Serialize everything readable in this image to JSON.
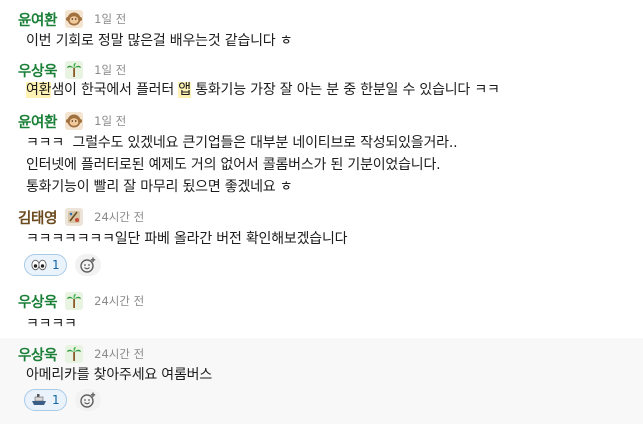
{
  "messages": [
    {
      "author": "윤여환",
      "avatar_icon": "monkey-emoji-icon",
      "time": "1일 전",
      "lines": [
        "이번 기회로 정말 많은걸 배우는것 같습니다 ㅎ"
      ]
    },
    {
      "author": "우상욱",
      "avatar_icon": "palm-tree-emoji-icon",
      "time": "1일 전",
      "mention": "여환",
      "rest": "샘이 한국에서 플러터 ",
      "highlight": "앱",
      "tail": " 통화기능 가장 잘 아는 분 중 한분일 수 있습니다 ㅋㅋ"
    },
    {
      "author": "윤여환",
      "avatar_icon": "monkey-emoji-icon",
      "time": "1일 전",
      "lines": [
        "ㅋㅋㅋ  그럴수도 있겠네요 큰기업들은 대부분 네이티브로 작성되있을거라..",
        "인터넷에 플러터로된 예제도 거의 없어서 콜롬버스가 된 기분이었습니다.",
        "통화기능이 빨리 잘 마무리 됬으면 좋겠네요 ㅎ"
      ]
    },
    {
      "author": "김태영",
      "avatar_icon": "artist-emoji-icon",
      "time": "24시간 전",
      "lines": [
        "ㅋㅋㅋㅋㅋㅋㅋ일단 파베 올라간 버전 확인해보겠습니다"
      ],
      "reaction": {
        "icon": "eyes-emoji-icon",
        "count": "1"
      }
    },
    {
      "author": "우상욱",
      "avatar_icon": "palm-tree-emoji-icon",
      "time": "24시간 전",
      "lines": [
        "ㅋㅋㅋㅋ"
      ]
    },
    {
      "author": "우상욱",
      "avatar_icon": "palm-tree-emoji-icon",
      "time": "24시간 전",
      "lines": [
        "아메리카를 찾아주세요 여롬버스"
      ],
      "reaction": {
        "icon": "ship-emoji-icon",
        "count": "1"
      }
    }
  ],
  "colors": {
    "author_name": "#1a7f37",
    "reaction_border": "#a9cbe8",
    "highlight": "#fdf2b3"
  }
}
